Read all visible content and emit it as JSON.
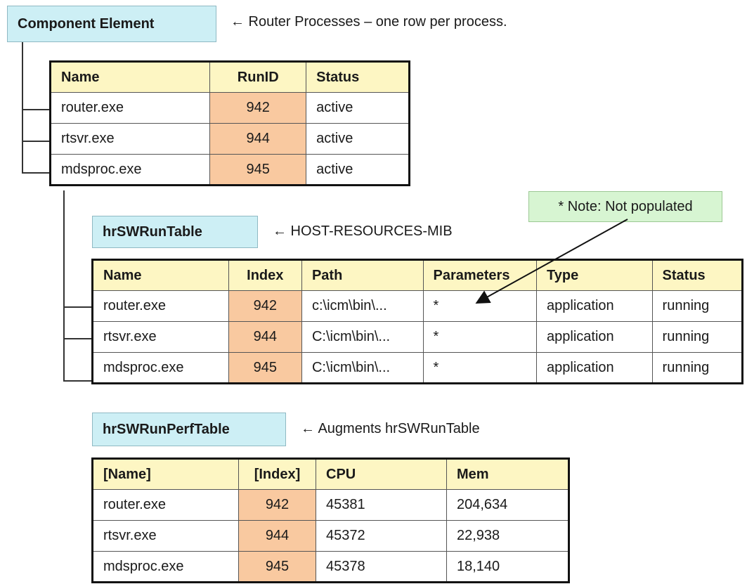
{
  "component": {
    "title": "Component Element",
    "caption": "← Router Processes – one row per process.",
    "headers": [
      "Name",
      "RunID",
      "Status"
    ],
    "rows": [
      [
        "router.exe",
        "942",
        "active"
      ],
      [
        "rtsvr.exe",
        "944",
        "active"
      ],
      [
        "mdsproc.exe",
        "945",
        "active"
      ]
    ]
  },
  "run_table": {
    "title": "hrSWRunTable",
    "caption": "← HOST-RESOURCES-MIB",
    "note": "* Note: Not populated",
    "headers": [
      "Name",
      "Index",
      "Path",
      "Parameters",
      "Type",
      "Status"
    ],
    "rows": [
      [
        "router.exe",
        "942",
        "c:\\icm\\bin\\...",
        "*",
        "application",
        "running"
      ],
      [
        "rtsvr.exe",
        "944",
        "C:\\icm\\bin\\...",
        "*",
        "application",
        "running"
      ],
      [
        "mdsproc.exe",
        "945",
        "C:\\icm\\bin\\...",
        "*",
        "application",
        "running"
      ]
    ]
  },
  "perf_table": {
    "title": "hrSWRunPerfTable",
    "caption": "← Augments hrSWRunTable",
    "headers": [
      "[Name]",
      "[Index]",
      "CPU",
      "Mem"
    ],
    "rows": [
      [
        "router.exe",
        "942",
        "45381",
        "204,634"
      ],
      [
        "rtsvr.exe",
        "944",
        "45372",
        "22,938"
      ],
      [
        "mdsproc.exe",
        "945",
        "45378",
        "18,140"
      ]
    ]
  },
  "colors": {
    "title_box": "#cdeff5",
    "header": "#fdf6c3",
    "index_cell": "#f9c9a0",
    "note_box": "#d7f5d2"
  }
}
